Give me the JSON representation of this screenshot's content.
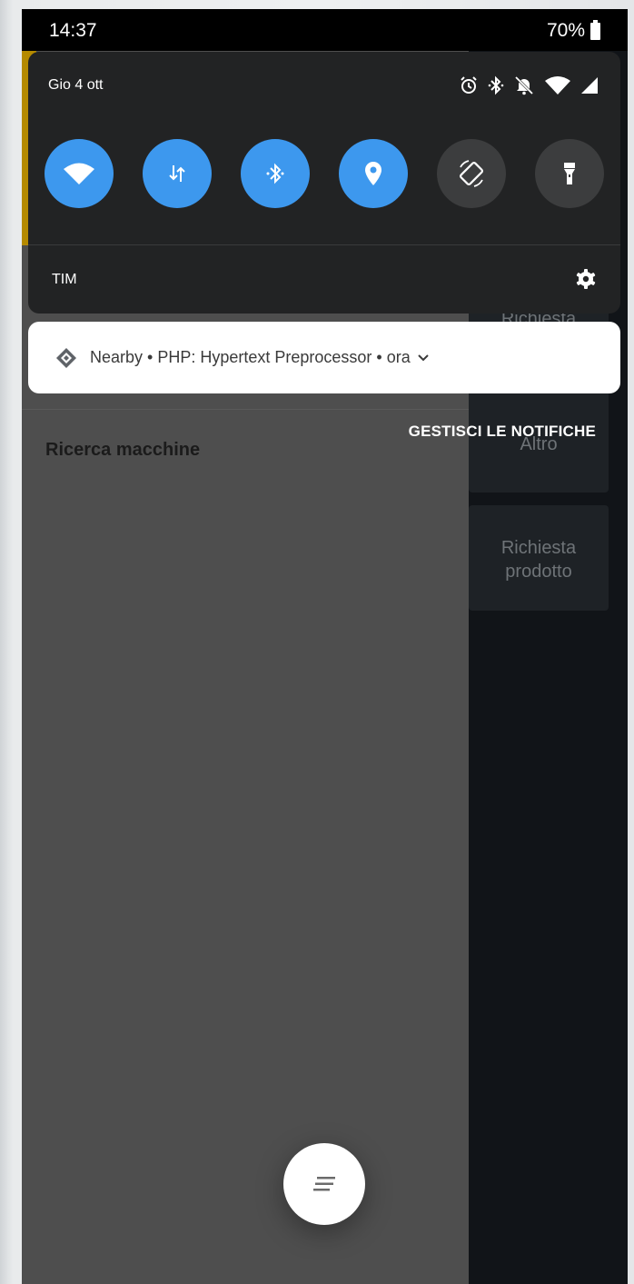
{
  "status_bar": {
    "time": "14:37",
    "battery": "70%"
  },
  "quick_settings": {
    "date": "Gio 4 ott",
    "carrier": "TIM",
    "tiles": [
      {
        "name": "wifi",
        "state": "on"
      },
      {
        "name": "mobile-data",
        "state": "on"
      },
      {
        "name": "bluetooth",
        "state": "on"
      },
      {
        "name": "location",
        "state": "on"
      },
      {
        "name": "auto-rotate",
        "state": "off"
      },
      {
        "name": "flashlight",
        "state": "off"
      }
    ],
    "status_icons": [
      "alarm-icon",
      "bluetooth-icon",
      "silent-icon",
      "wifi-icon",
      "signal-icon"
    ]
  },
  "notification": {
    "app": "Nearby",
    "title": "PHP: Hypertext Preprocessor",
    "time": "ora",
    "text": "Nearby • PHP: Hypertext Preprocessor • ora"
  },
  "manage_notifications": "GESTISCI LE NOTIFICHE",
  "app": {
    "title": "Ricerca macchine",
    "cards": {
      "top": "Richiesta",
      "altro": "Altro",
      "richiesta_prodotto_line1": "Richiesta",
      "richiesta_prodotto_line2": "prodotto"
    }
  },
  "colors": {
    "accent": "#3d98ee",
    "panel": "#222324",
    "tile_off": "#3c3d3e"
  }
}
